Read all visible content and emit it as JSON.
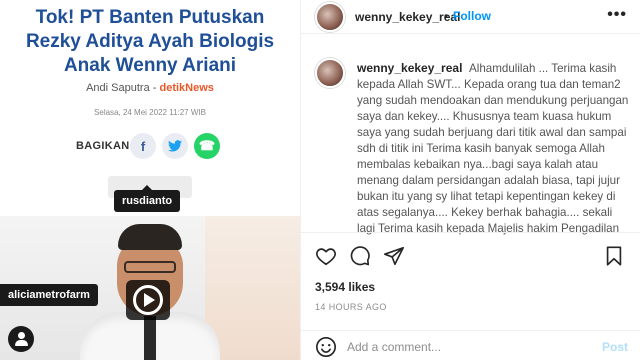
{
  "article": {
    "headline": "Tok! PT Banten Putuskan Rezky Aditya Ayah Biologis Anak Wenny Ariani",
    "author": "Andi Saputra",
    "separator": " - ",
    "source": "detikNews",
    "date": "Selasa, 24 Mei 2022 11:27 WIB",
    "share_label": "BAGIKAN",
    "share_fb_icon": "f",
    "share_tw_icon": "•",
    "share_wa_icon": "☎"
  },
  "tags": {
    "first": "rusdianto",
    "second": "aliciametrofarm"
  },
  "post": {
    "username": "wenny_kekey_real",
    "dot": "•",
    "follow_label": "Follow",
    "more_label": "•••",
    "caption_user": "wenny_kekey_real",
    "caption_text": "Alhamdulilah ... Terima kasih kepada Allah SWT... Kepada orang tua dan teman2 yang sudah mendoakan dan mendukung perjuangan saya dan kekey.... Khususnya team kuasa hukum saya yang sudah berjuang dari titik awal dan sampai sdh di titik ini Terima kasih banyak semoga Allah membalas kebaikan nya...bagi saya kalah atau menang dalam persidangan adalah biasa, tapi jujur bukan itu yang sy lihat tetapi kepentingan kekey di atas segalanya.... Kekey berhak bahagia.... sekali lagi Terima kasih kepada Majelis hakim Pengadilan",
    "likes": "3,594 likes",
    "time": "14 HOURS AGO",
    "comment_placeholder": "Add a comment...",
    "post_label": "Post"
  }
}
